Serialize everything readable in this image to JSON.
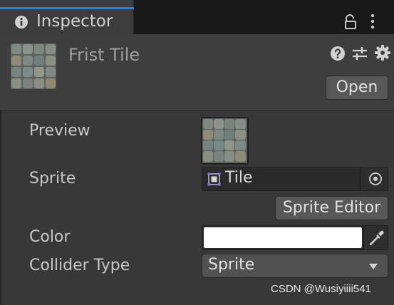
{
  "tab": {
    "title": "Inspector",
    "icon": "info-icon",
    "accent_color": "#2f7fd3"
  },
  "tab_actions": {
    "lock_icon": "lock-icon",
    "menu_icon": "kebab-menu-icon"
  },
  "header": {
    "title": "Frist Tile",
    "open_label": "Open",
    "help_icon": "help-icon",
    "presets_icon": "presets-sliders-icon",
    "settings_icon": "gear-icon"
  },
  "fields": {
    "preview_label": "Preview",
    "sprite_label": "Sprite",
    "sprite_value": "Tile",
    "sprite_editor_label": "Sprite Editor",
    "color_label": "Color",
    "color_value": "#ffffff",
    "collider_label": "Collider Type",
    "collider_value": "Sprite"
  },
  "watermark": "CSDN @Wusiyiiii541"
}
